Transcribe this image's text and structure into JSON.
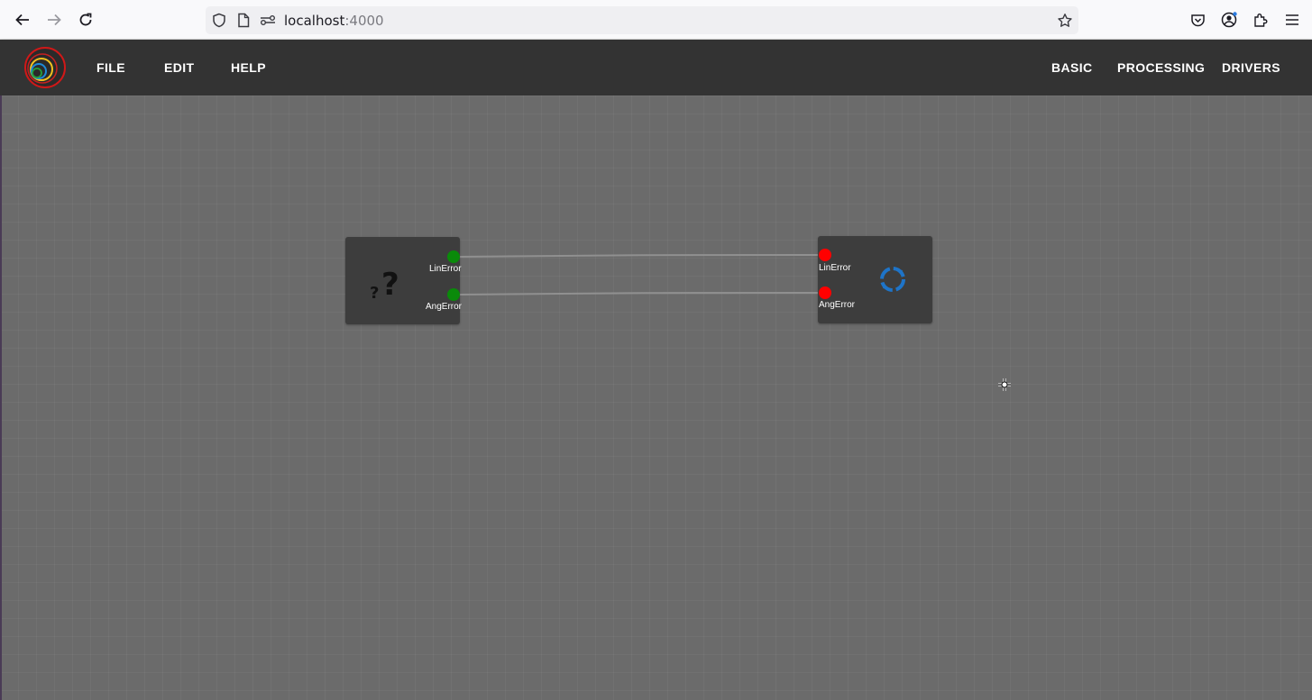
{
  "browser": {
    "url_host": "localhost",
    "url_port": ":4000",
    "icons": [
      "back-arrow-icon",
      "forward-arrow-icon",
      "reload-icon",
      "shield-icon",
      "page-icon",
      "permissions-icon",
      "bookmark-star-icon",
      "pocket-icon",
      "account-icon",
      "extensions-icon",
      "hamburger-menu-icon"
    ]
  },
  "app": {
    "logo": "concentric-circles-logo",
    "menu_left": [
      "FILE",
      "EDIT",
      "HELP"
    ],
    "menu_right": [
      "BASIC",
      "PROCESSING",
      "DRIVERS"
    ]
  },
  "graph": {
    "nodes": [
      {
        "id": "source-node",
        "icon": "question-mark-icon",
        "ports": [
          {
            "label": "LinError",
            "color": "#0a8a0a"
          },
          {
            "label": "AngError",
            "color": "#0a8a0a"
          }
        ]
      },
      {
        "id": "target-node",
        "icon": "refresh-circle-icon",
        "icon_color": "#1e74c8",
        "ports": [
          {
            "label": "LinError",
            "color": "#ff0000"
          },
          {
            "label": "AngError",
            "color": "#ff0000"
          }
        ]
      }
    ],
    "connections": [
      {
        "from": "LinError",
        "to": "LinError"
      },
      {
        "from": "AngError",
        "to": "AngError"
      }
    ]
  }
}
